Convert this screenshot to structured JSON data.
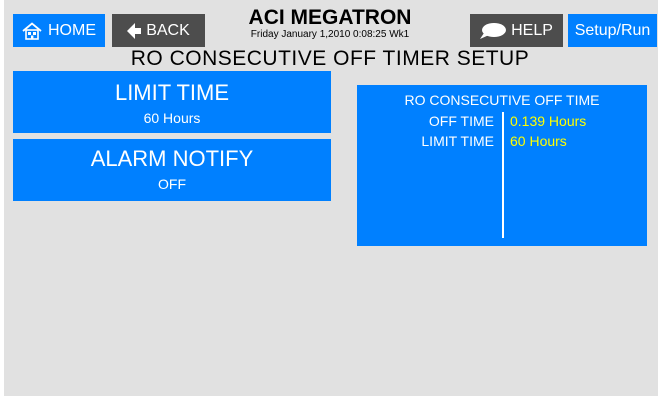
{
  "header": {
    "home_label": "HOME",
    "back_label": "BACK",
    "title": "ACI MEGATRON",
    "datetime": "Friday January 1,2010 0:08:25 Wk1",
    "help_label": "HELP",
    "setup_label": "Setup/Run"
  },
  "page_title": "RO CONSECUTIVE OFF TIMER SETUP",
  "controls": {
    "limit_time": {
      "label": "LIMIT TIME",
      "value": "60 Hours"
    },
    "alarm_notify": {
      "label": "ALARM NOTIFY",
      "value": "OFF"
    }
  },
  "status_panel": {
    "heading": "RO CONSECUTIVE OFF TIME",
    "rows": [
      {
        "label": "OFF TIME",
        "value": "0.139 Hours"
      },
      {
        "label": "LIMIT TIME",
        "value": "60 Hours"
      }
    ],
    "value_color": "#ffff00"
  },
  "colors": {
    "accent": "#0080ff",
    "back_button": "#4d4d4d",
    "background": "#e1e1e1"
  },
  "icons": {
    "home": "home-icon",
    "back": "arrow-left-icon",
    "help": "speech-bubble-icon"
  }
}
